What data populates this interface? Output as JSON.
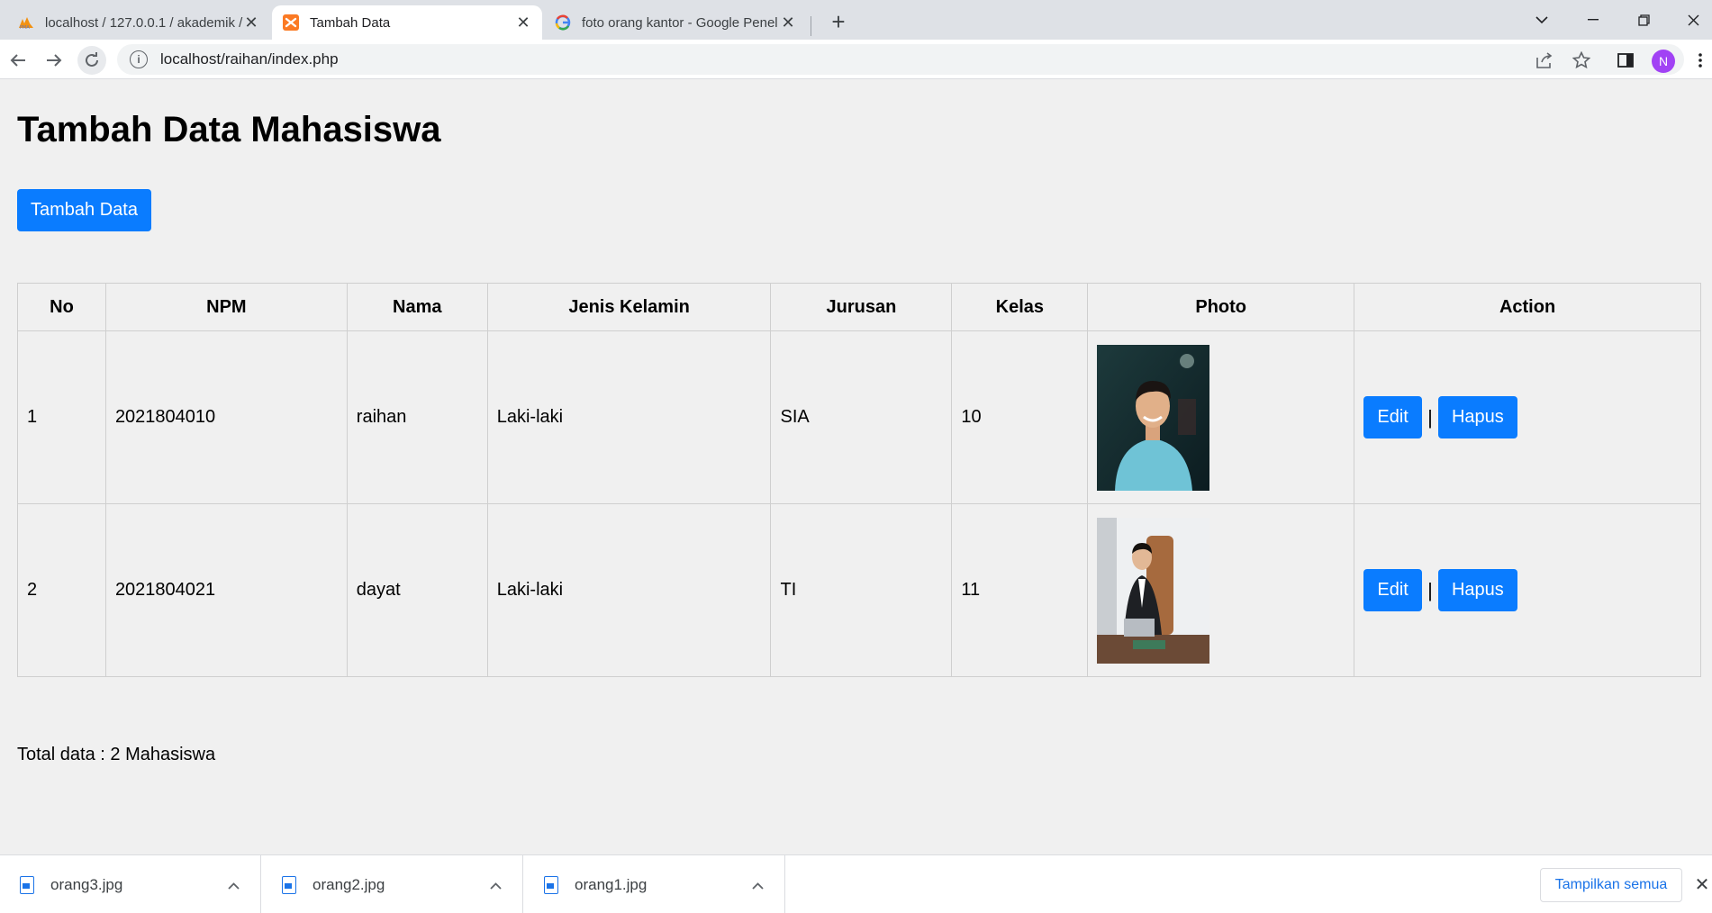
{
  "browser": {
    "tabs": [
      {
        "title": "localhost / 127.0.0.1 / akademik /",
        "icon": "phpmyadmin-icon"
      },
      {
        "title": "Tambah Data",
        "icon": "xampp-icon"
      },
      {
        "title": "foto orang kantor - Google Penel",
        "icon": "google-icon"
      }
    ],
    "url": "localhost/raihan/index.php",
    "profile_initial": "N"
  },
  "page": {
    "heading": "Tambah Data Mahasiswa",
    "add_button": "Tambah Data",
    "table": {
      "headers": [
        "No",
        "NPM",
        "Nama",
        "Jenis Kelamin",
        "Jurusan",
        "Kelas",
        "Photo",
        "Action"
      ],
      "rows": [
        {
          "no": "1",
          "npm": "2021804010",
          "nama": "raihan",
          "jk": "Laki-laki",
          "jurusan": "SIA",
          "kelas": "10"
        },
        {
          "no": "2",
          "npm": "2021804021",
          "nama": "dayat",
          "jk": "Laki-laki",
          "jurusan": "TI",
          "kelas": "11"
        }
      ],
      "edit_label": "Edit",
      "separator": "|",
      "delete_label": "Hapus"
    },
    "total": "Total data : 2 Mahasiswa"
  },
  "downloads": {
    "items": [
      "orang3.jpg",
      "orang2.jpg",
      "orang1.jpg"
    ],
    "show_all": "Tampilkan semua"
  },
  "colors": {
    "button_blue": "#0a7cff",
    "page_bg": "#f0f0f0"
  }
}
